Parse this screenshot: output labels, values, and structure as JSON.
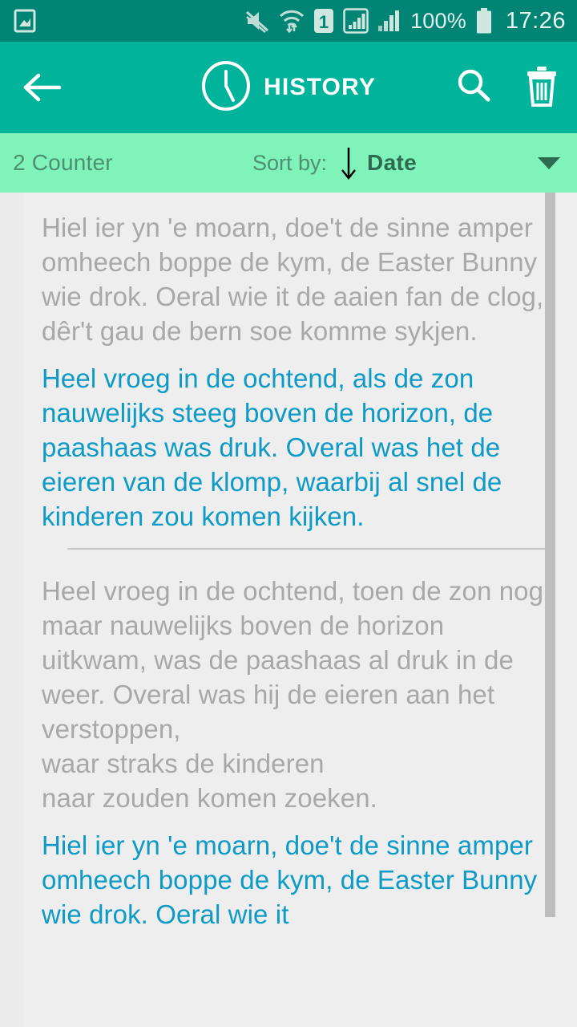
{
  "statusbar": {
    "notification_icon": "image-icon",
    "icons": [
      "mute-icon",
      "wifi-icon",
      "sim-1-icon",
      "signal-boxed-icon",
      "signal-bars-icon"
    ],
    "sim_label": "1",
    "battery_percent": "100%",
    "battery_icon": "battery-full-icon",
    "time": "17:26"
  },
  "appbar": {
    "back_icon": "back-arrow-icon",
    "clock_icon": "clock-icon",
    "title": "HISTORY",
    "search_icon": "search-icon",
    "delete_icon": "trash-icon",
    "background_color": "#00b39b"
  },
  "sortbar": {
    "counter": "2 Counter",
    "sort_label": "Sort by:",
    "sort_direction_icon": "arrow-down-icon",
    "sort_value": "Date",
    "dropdown_icon": "caret-down-icon",
    "background_color": "#7ff3b9"
  },
  "colors": {
    "status_bar": "#008575",
    "accent_teal": "#00b39b",
    "sort_green": "#7ff3b9",
    "source_text": "#a8a8a8",
    "translation_text": "#0d9ac6",
    "content_bg": "#eeeeee"
  },
  "history": {
    "items": [
      {
        "source_text": "Hiel ier yn 'e moarn, doe't de sinne amper omheech boppe de kym, de Easter Bunny wie drok. Oeral wie it de aaien fan de clog, dêr't gau de bern soe komme sykjen.",
        "translated_text": "Heel vroeg in de ochtend, als de zon nauwelijks steeg boven de horizon, de paashaas was druk. Overal was het de eieren van de klomp, waarbij al snel de kinderen zou komen kijken."
      },
      {
        "source_text": "Heel vroeg in de ochtend, toen de zon nog maar nauwelijks boven de horizon uitkwam, was de paashaas al druk in de weer. Overal was hij de eieren aan het verstoppen,\nwaar straks de kinderen\nnaar zouden komen zoeken.",
        "translated_text": "Hiel ier yn 'e moarn, doe't de sinne amper omheech boppe de kym, de Easter Bunny wie drok. Oeral wie it"
      }
    ]
  }
}
